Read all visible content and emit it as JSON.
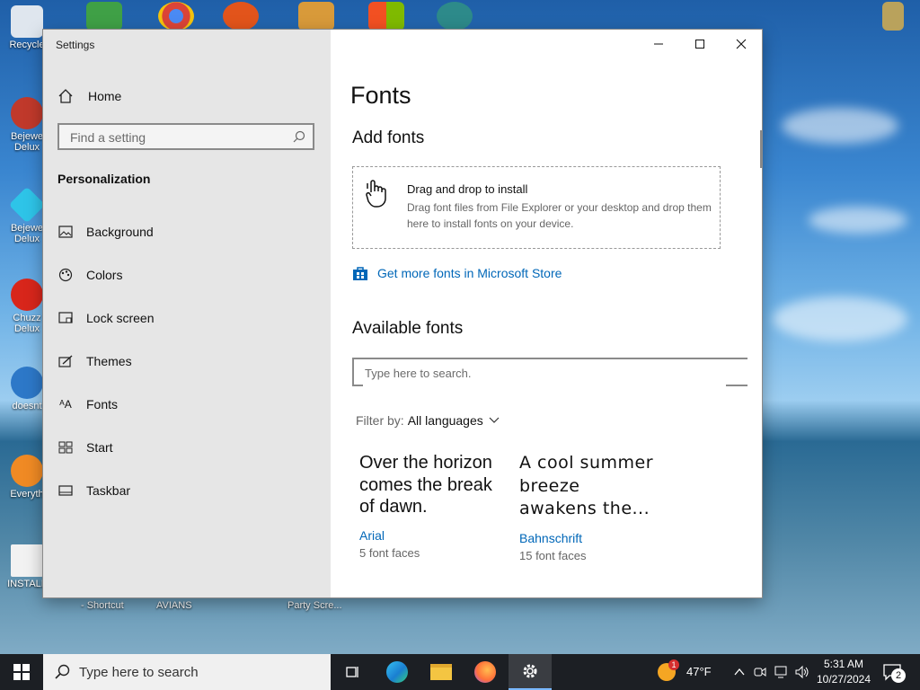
{
  "desktop": {
    "icons_left": [
      {
        "label": "Recycle",
        "icon": "recycle-bin-icon"
      },
      {
        "label": "Bejewe Delux",
        "icon": "bejeweled-icon"
      },
      {
        "label": "Bejewe Delux",
        "icon": "bejeweled-diamond-icon"
      },
      {
        "label": "Chuzz Delux",
        "icon": "chuzzle-icon"
      },
      {
        "label": "doesnt",
        "icon": "app-icon"
      },
      {
        "label": "Everyth",
        "icon": "everything-search-icon"
      },
      {
        "label": "INSTALL",
        "icon": "text-file-icon"
      }
    ],
    "bottom_labels": [
      "- Shortcut",
      "AVIANS",
      "Party Scre..."
    ]
  },
  "window": {
    "title": "Settings",
    "home_label": "Home",
    "search_placeholder": "Find a setting",
    "section_header": "Personalization",
    "nav_items": [
      {
        "label": "Background",
        "icon": "picture-icon"
      },
      {
        "label": "Colors",
        "icon": "palette-icon"
      },
      {
        "label": "Lock screen",
        "icon": "lock-screen-icon"
      },
      {
        "label": "Themes",
        "icon": "themes-brush-icon"
      },
      {
        "label": "Fonts",
        "icon": "fonts-icon"
      },
      {
        "label": "Start",
        "icon": "start-grid-icon"
      },
      {
        "label": "Taskbar",
        "icon": "taskbar-icon"
      }
    ]
  },
  "main": {
    "page_title": "Fonts",
    "add_fonts_header": "Add fonts",
    "drop_title": "Drag and drop to install",
    "drop_desc": "Drag font files from File Explorer or your desktop and drop them here to install fonts on your device.",
    "store_link": "Get more fonts in Microsoft Store",
    "available_header": "Available fonts",
    "font_search_placeholder": "Type here to search.",
    "filter_label": "Filter by:",
    "filter_value": "All languages",
    "fonts": [
      {
        "sample": "Over the horizon comes the break of dawn.",
        "name": "Arial",
        "faces": "5 font faces"
      },
      {
        "sample": "A cool summer breeze awakens the...",
        "name": "Bahnschrift",
        "faces": "15 font faces"
      }
    ]
  },
  "taskbar": {
    "search_placeholder": "Type here to search",
    "weather_temp": "47°F",
    "weather_badge": "1",
    "time": "5:31 AM",
    "date": "10/27/2024",
    "notification_count": "2"
  }
}
